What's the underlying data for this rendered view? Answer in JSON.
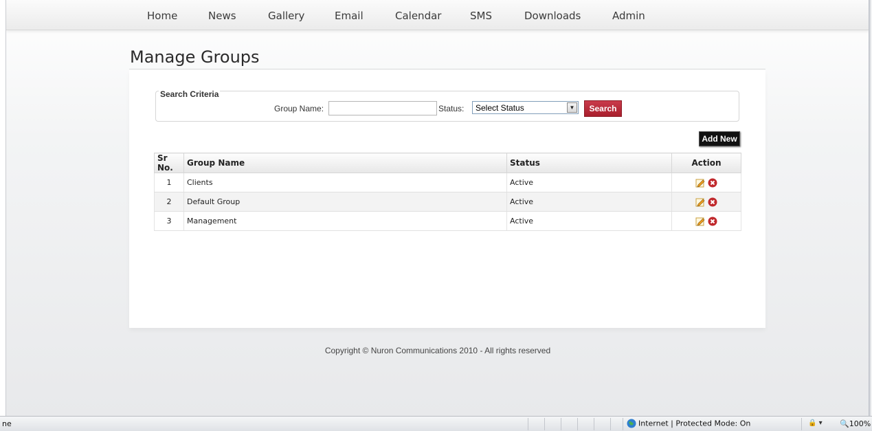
{
  "nav": {
    "items": [
      "Home",
      "News",
      "Gallery",
      "Email",
      "Calendar",
      "SMS",
      "Downloads",
      "Admin"
    ]
  },
  "page": {
    "title": "Manage Groups"
  },
  "search": {
    "legend": "Search Criteria",
    "group_name_label": "Group Name:",
    "group_name_value": "",
    "status_label": "Status:",
    "status_selected": "Select Status",
    "search_button": "Search"
  },
  "add_button": "Add New",
  "table": {
    "headers": {
      "sr": "Sr No.",
      "name": "Group Name",
      "status": "Status",
      "action": "Action"
    },
    "rows": [
      {
        "sr": "1",
        "name": "Clients",
        "status": "Active"
      },
      {
        "sr": "2",
        "name": "Default Group",
        "status": "Active"
      },
      {
        "sr": "3",
        "name": "Management",
        "status": "Active"
      }
    ]
  },
  "footer": {
    "copyright": "Copyright © Nuron Communications 2010 - All rights reserved"
  },
  "statusbar": {
    "left_text": "ne",
    "zone_text": "Internet | Protected Mode: On",
    "zoom": "100%"
  },
  "colors": {
    "search_button": "#b0232f",
    "add_button": "#111111",
    "delete_icon": "#c0282c"
  }
}
